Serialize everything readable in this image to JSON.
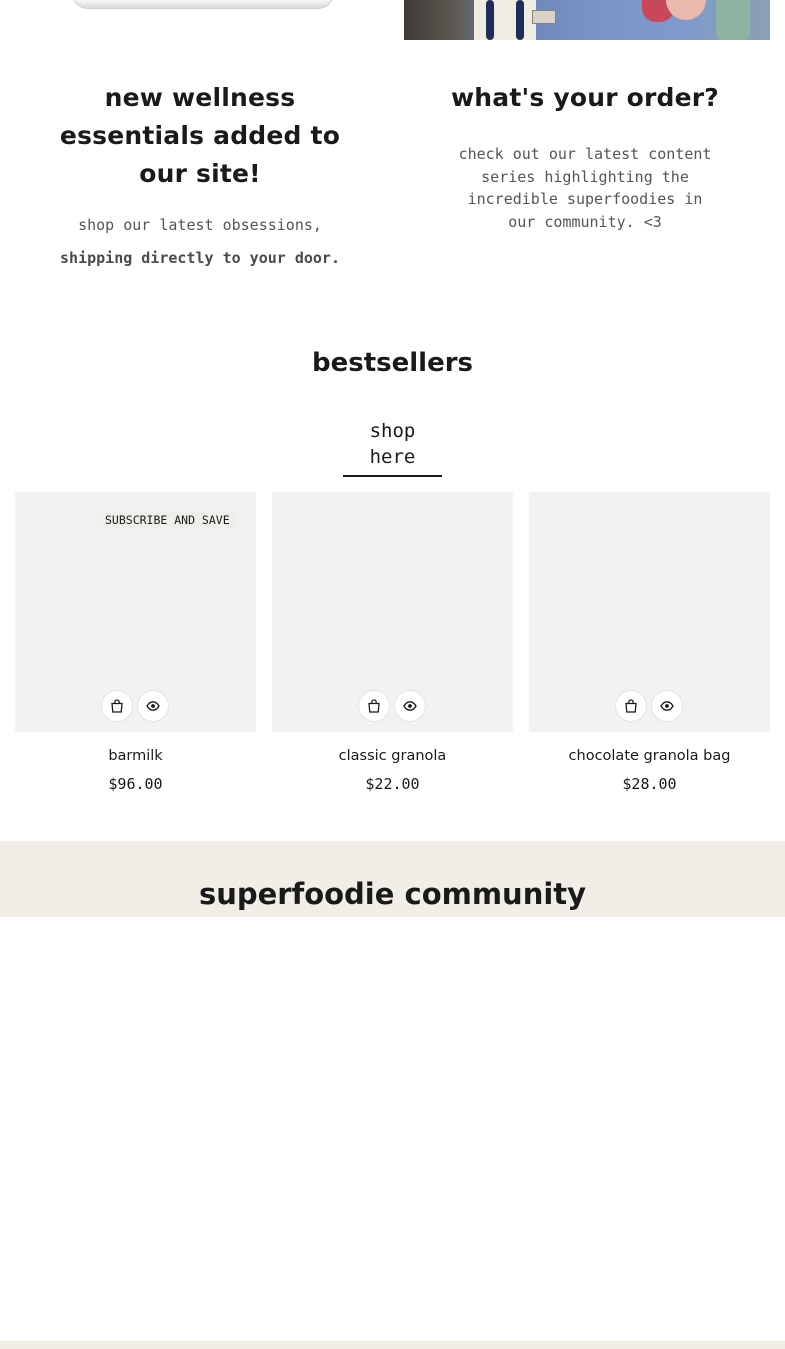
{
  "promo": {
    "left": {
      "heading_line1": "new wellness",
      "heading_line2": "essentials added to",
      "heading_line3": "our site!",
      "sub1": "shop our latest obsessions,",
      "sub2": "shipping directly to your door."
    },
    "right": {
      "heading": "what's your order?",
      "sub": "check out our latest content series highlighting the incredible superfoodies in our community. <3"
    }
  },
  "bestsellers": {
    "title": "bestsellers",
    "link_label": "shop here",
    "products": [
      {
        "name": "barmilk",
        "price": "$96.00",
        "badge": "SUBSCRIBE AND SAVE"
      },
      {
        "name": "classic granola",
        "price": "$22.00"
      },
      {
        "name": "chocolate granola bag",
        "price": "$28.00"
      }
    ]
  },
  "community": {
    "title": "superfoodie community"
  },
  "icons": {
    "quick_add": "shopping-bag-icon",
    "quick_view": "eye-icon"
  },
  "colors": {
    "card_background": "#f2f2f2",
    "community_band": "#f0eee6",
    "text": "#1a1a1a",
    "muted_text": "#555555"
  }
}
